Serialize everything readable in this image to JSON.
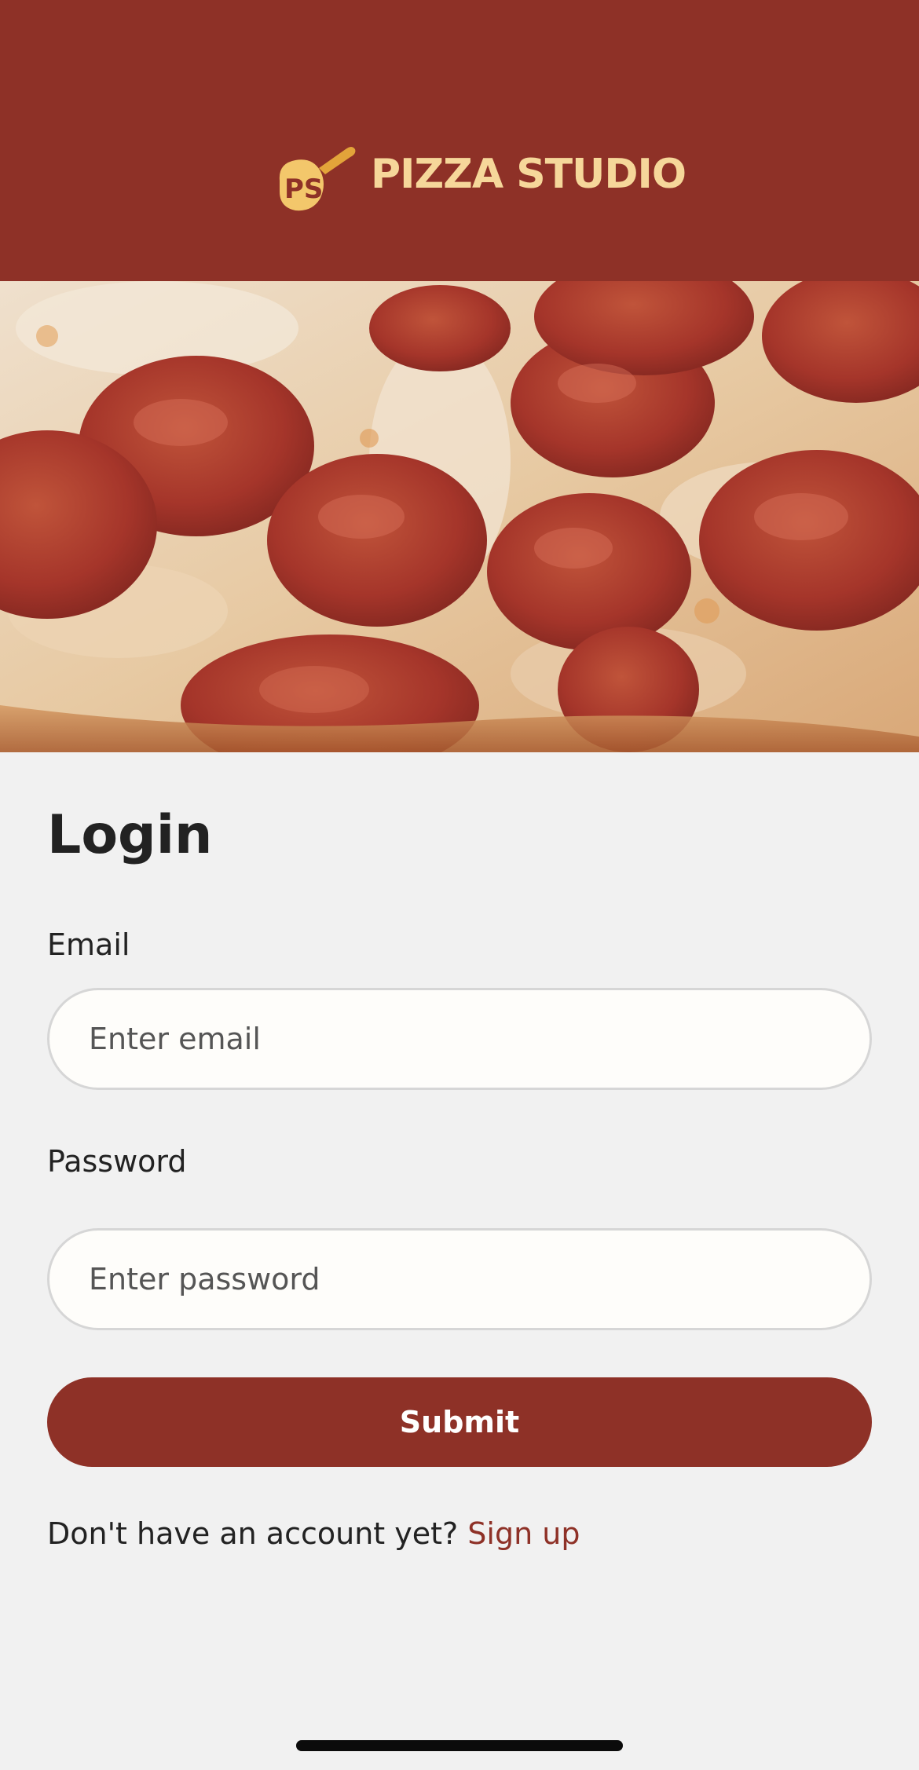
{
  "brand": {
    "name": "PIZZA STUDIO",
    "logo_icon": "pizza-studio-logo-icon",
    "header_color": "#8e3127",
    "logo_color": "#f6d79a",
    "accent_color": "#e3a43a"
  },
  "hero": {
    "image": "pepperoni-pizza-photo"
  },
  "login": {
    "title": "Login",
    "email_label": "Email",
    "email_placeholder": "Enter email",
    "email_value": "",
    "password_label": "Password",
    "password_placeholder": "Enter password",
    "password_value": "",
    "submit_label": "Submit",
    "signup_prompt": "Don't have an account yet?",
    "signup_link": "Sign up",
    "button_color": "#8e3127",
    "link_color": "#8e3127"
  }
}
